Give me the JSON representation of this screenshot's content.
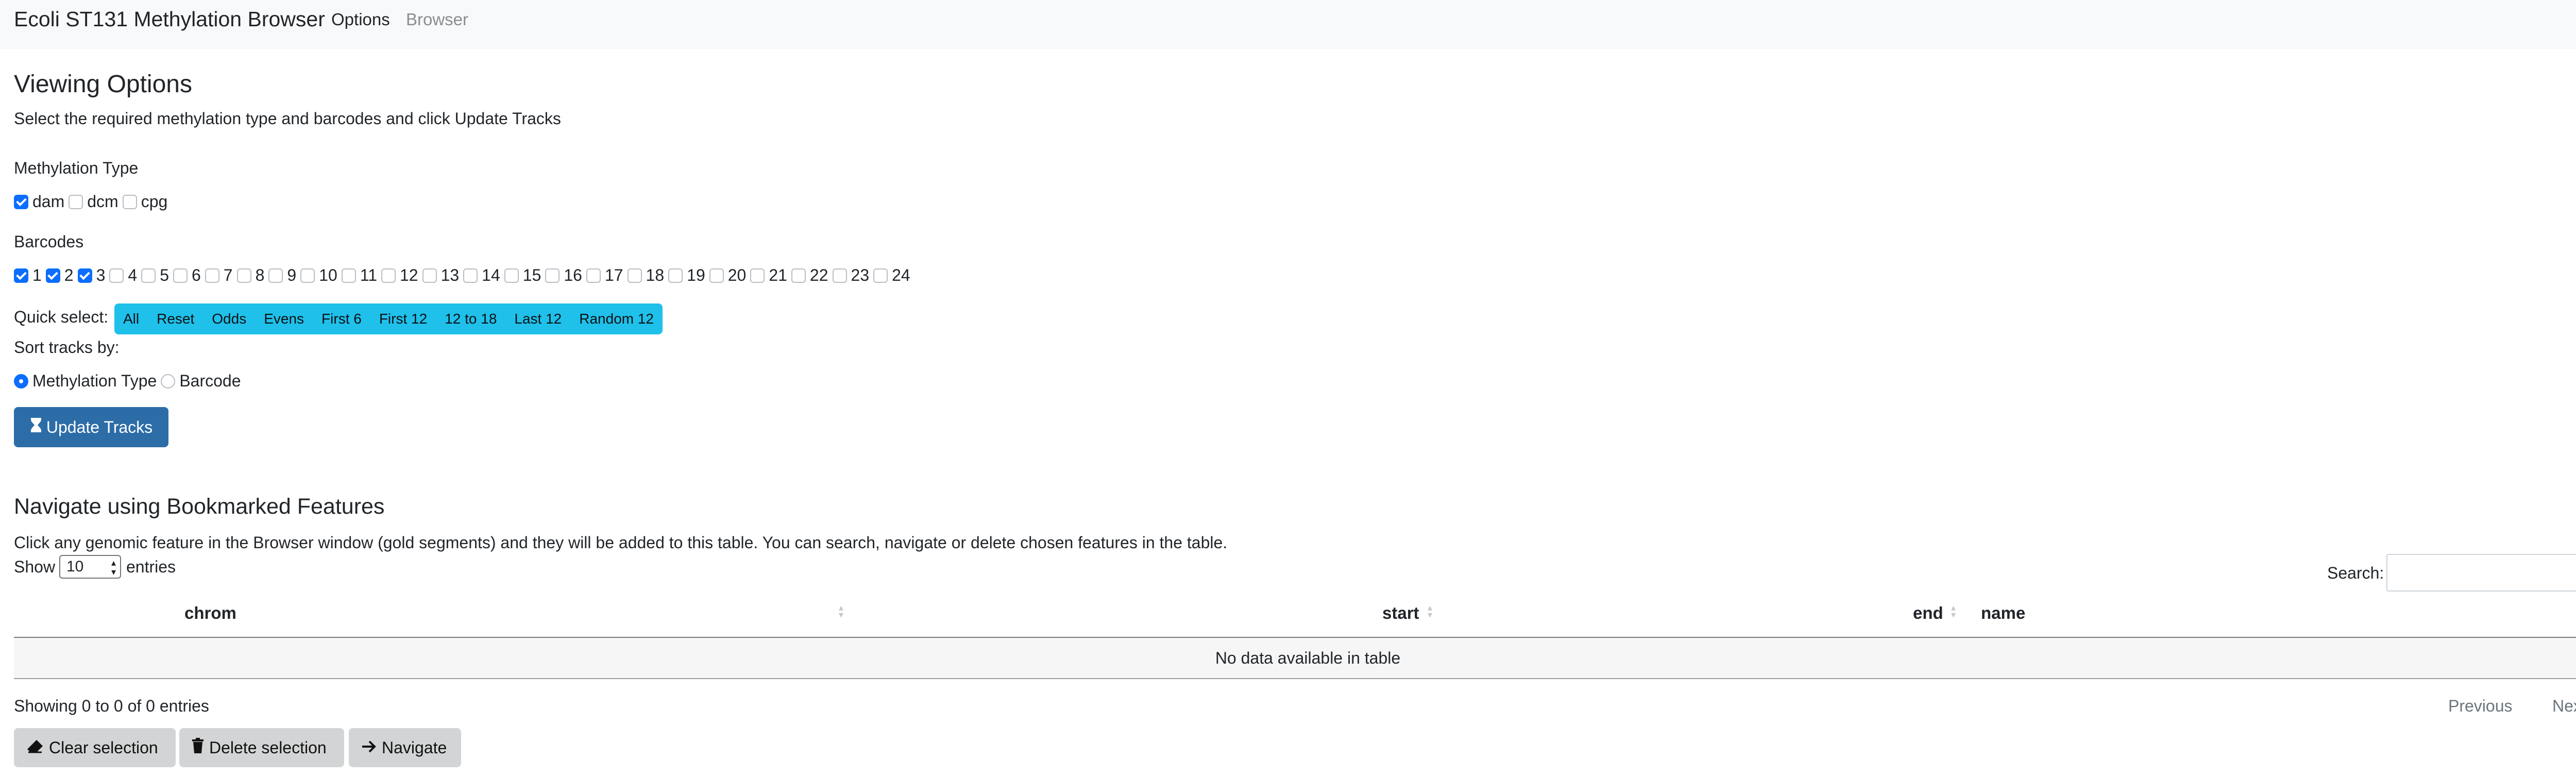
{
  "navbar": {
    "brand": "Ecoli ST131 Methylation Browser",
    "links": [
      {
        "label": "Options"
      },
      {
        "label": "Browser"
      }
    ]
  },
  "viewing": {
    "title": "Viewing Options",
    "description": "Select the required methylation type and barcodes and click Update Tracks"
  },
  "methylation": {
    "label": "Methylation Type",
    "options": [
      {
        "label": "dam",
        "checked": true
      },
      {
        "label": "dcm",
        "checked": false
      },
      {
        "label": "cpg",
        "checked": false
      }
    ]
  },
  "barcodes": {
    "label": "Barcodes",
    "options": [
      {
        "label": "1",
        "checked": true
      },
      {
        "label": "2",
        "checked": true
      },
      {
        "label": "3",
        "checked": true
      },
      {
        "label": "4",
        "checked": false
      },
      {
        "label": "5",
        "checked": false
      },
      {
        "label": "6",
        "checked": false
      },
      {
        "label": "7",
        "checked": false
      },
      {
        "label": "8",
        "checked": false
      },
      {
        "label": "9",
        "checked": false
      },
      {
        "label": "10",
        "checked": false
      },
      {
        "label": "11",
        "checked": false
      },
      {
        "label": "12",
        "checked": false
      },
      {
        "label": "13",
        "checked": false
      },
      {
        "label": "14",
        "checked": false
      },
      {
        "label": "15",
        "checked": false
      },
      {
        "label": "16",
        "checked": false
      },
      {
        "label": "17",
        "checked": false
      },
      {
        "label": "18",
        "checked": false
      },
      {
        "label": "19",
        "checked": false
      },
      {
        "label": "20",
        "checked": false
      },
      {
        "label": "21",
        "checked": false
      },
      {
        "label": "22",
        "checked": false
      },
      {
        "label": "23",
        "checked": false
      },
      {
        "label": "24",
        "checked": false
      }
    ]
  },
  "quick_select": {
    "label": "Quick select:",
    "buttons": [
      "All",
      "Reset",
      "Odds",
      "Evens",
      "First 6",
      "First 12",
      "12 to 18",
      "Last 12",
      "Random 12"
    ]
  },
  "sort": {
    "label": "Sort tracks by:",
    "options": [
      {
        "label": "Methylation Type",
        "selected": true
      },
      {
        "label": "Barcode",
        "selected": false
      }
    ]
  },
  "update_button": {
    "label": "Update Tracks",
    "icon": "hourglass-icon"
  },
  "bookmarks": {
    "title": "Navigate using Bookmarked Features",
    "description": "Click any genomic feature in the Browser window (gold segments) and they will be added to this table. You can search, navigate or delete chosen features in the table.",
    "show_label": "Show",
    "page_size": "10",
    "entries_label": "entries",
    "search_label": "Search:",
    "search_value": "",
    "columns": [
      "chrom",
      "start",
      "end",
      "name"
    ],
    "empty_text": "No data available in table",
    "info": "Showing 0 to 0 of 0 entries",
    "previous": "Previous",
    "next": "Next"
  },
  "actions": [
    {
      "label": "Clear selection",
      "icon": "eraser-icon"
    },
    {
      "label": "Delete selection",
      "icon": "trash-icon"
    },
    {
      "label": "Navigate",
      "icon": "arrow-right-icon"
    }
  ],
  "colors": {
    "primary": "#2c6da8",
    "info": "#1fc1ea",
    "checkbox": "#0d6efd",
    "secondary": "#d3d4d5"
  }
}
